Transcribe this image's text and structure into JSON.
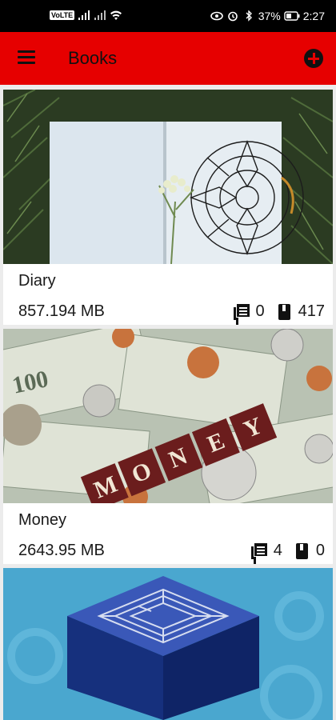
{
  "status_bar": {
    "carrier_chip": "VoLTE",
    "battery": "37%",
    "time": "2:27"
  },
  "app_bar": {
    "title": "Books",
    "menu_icon": "hamburger-menu-icon",
    "add_icon": "add-circle-icon",
    "accent": "#e60000"
  },
  "books": [
    {
      "title": "Diary",
      "size": "857.194 MB",
      "notes_count": "0",
      "pages_count": "417"
    },
    {
      "title": "Money",
      "size": "2643.95 MB",
      "notes_count": "4",
      "pages_count": "0"
    },
    {
      "title": "",
      "size": "",
      "notes_count": "",
      "pages_count": ""
    }
  ]
}
